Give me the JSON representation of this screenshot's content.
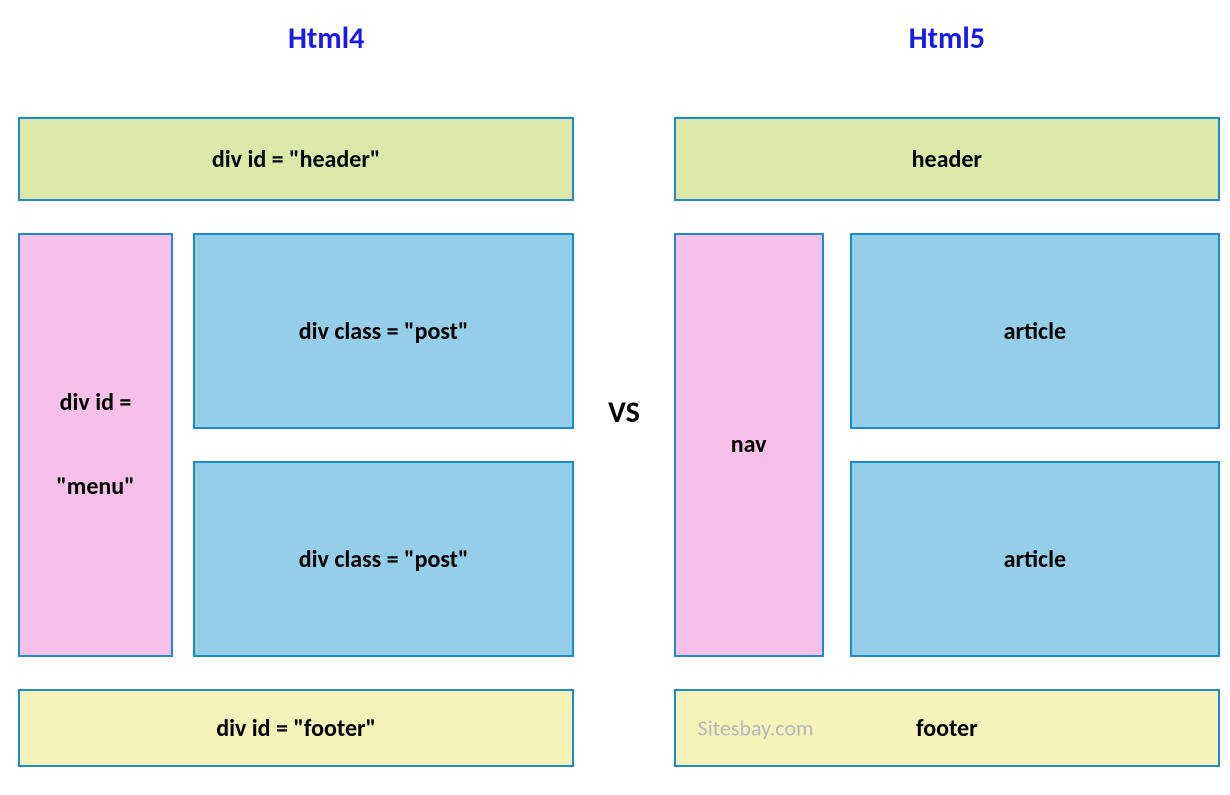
{
  "left": {
    "title": "Html4",
    "header": "div id = \"header\"",
    "menu_line1": "div id =",
    "menu_line2": "\"menu\"",
    "post1": "div class = \"post\"",
    "post2": "div class = \"post\"",
    "footer": "div id = \"footer\""
  },
  "vs": "VS",
  "right": {
    "title": "Html5",
    "header": "header",
    "nav": "nav",
    "article1": "article",
    "article2": "article",
    "footer": "footer",
    "watermark": "Sitesbay.com"
  }
}
